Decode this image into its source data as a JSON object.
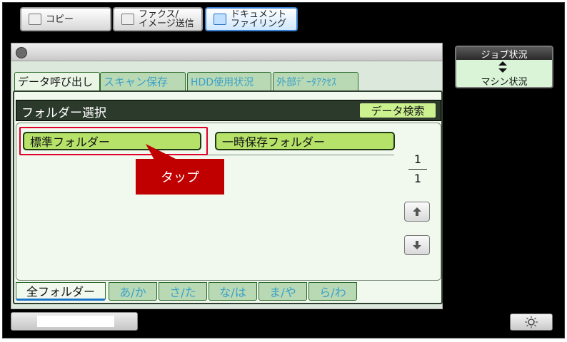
{
  "mode_tabs": [
    {
      "label": "コピー",
      "active": false
    },
    {
      "label": "ファクス/\nイメージ送信",
      "active": false
    },
    {
      "label": "ドキュメント\nファイリング",
      "active": true
    }
  ],
  "function_tabs": [
    {
      "label": "データ呼び出し",
      "active": true
    },
    {
      "label": "スキャン保存",
      "active": false
    },
    {
      "label": "HDD使用状況",
      "active": false
    },
    {
      "label": "外部ﾃﾞｰﾀｱｸｾｽ",
      "active": false
    }
  ],
  "folder_select": {
    "title": "フォルダー選択",
    "search_button": "データ検索",
    "folders": [
      "標準フォルダー",
      "一時保存フォルダー"
    ]
  },
  "callout": {
    "text": "タップ",
    "color": "#c00000",
    "highlight_color": "#e0002a"
  },
  "pagination": {
    "current": "1",
    "total": "1",
    "up_icon": "arrow-up-icon",
    "down_icon": "arrow-down-icon"
  },
  "index_tabs": [
    {
      "label": "全フォルダー",
      "active": true
    },
    {
      "label": "あ/か",
      "active": false
    },
    {
      "label": "さ/た",
      "active": false
    },
    {
      "label": "な/は",
      "active": false
    },
    {
      "label": "ま/や",
      "active": false
    },
    {
      "label": "ら/わ",
      "active": false
    }
  ],
  "status_panel": {
    "job_status": "ジョブ状況",
    "machine_status": "マシン状況"
  },
  "colors": {
    "accent_green": "#b6e26a",
    "tab_inactive": "#b9d9b5",
    "doc_tab_highlight": "#3a7fd0"
  },
  "icons": {
    "doc_filing": "document-filing-icon",
    "brightness": "brightness-icon"
  }
}
